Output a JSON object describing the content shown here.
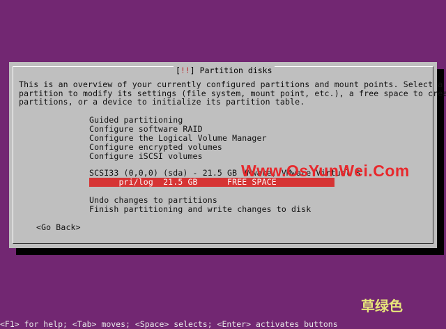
{
  "dialog": {
    "title_left": "[!!]",
    "title": "Partition disks",
    "intro_lines": [
      "This is an overview of your currently configured partitions and mount points. Select a",
      "partition to modify its settings (file system, mount point, etc.), a free space to create",
      "partitions, or a device to initialize its partition table."
    ],
    "menu": [
      "Guided partitioning",
      "Configure software RAID",
      "Configure the Logical Volume Manager",
      "Configure encrypted volumes",
      "Configure iSCSI volumes"
    ],
    "device": "SCSI33 (0,0,0) (sda) - 21.5 GB VMware, VMware Virtual S",
    "selected_partition": "      pri/log  21.5 GB      FREE SPACE",
    "actions": [
      "Undo changes to partitions",
      "Finish partitioning and write changes to disk"
    ],
    "go_back": "<Go Back>"
  },
  "watermark": "Www.OsYunWei.Com",
  "brand": "草绿色",
  "help_bar": "<F1> for help; <Tab> moves; <Space> selects; <Enter> activates buttons",
  "colors": {
    "background": "#722772",
    "dialog": "#bfbfbf",
    "selection": "#d63434",
    "title": "#b8282a"
  }
}
